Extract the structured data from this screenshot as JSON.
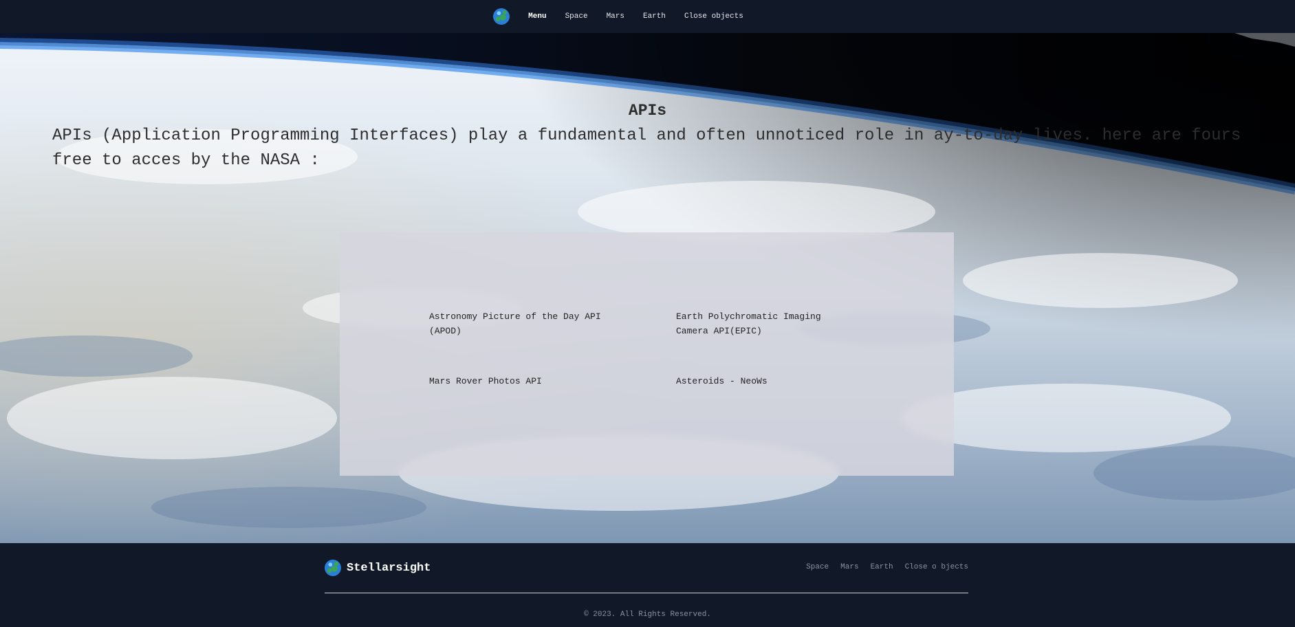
{
  "nav": {
    "logo_icon": "globe-icon",
    "items": [
      {
        "label": "Menu",
        "active": true
      },
      {
        "label": "Space"
      },
      {
        "label": "Mars"
      },
      {
        "label": "Earth"
      },
      {
        "label": "Close objects"
      }
    ]
  },
  "hero": {
    "title": "APIs",
    "description": "APIs (Application Programming Interfaces) play a fundamental and often unnoticed role in ay-to-day lives. here are fours free to acces by the NASA :",
    "apis": [
      {
        "label": "Astronomy Picture of the Day API (APOD)"
      },
      {
        "label": "Earth Polychromatic Imaging Camera API(EPIC)"
      },
      {
        "label": "Mars Rover Photos API"
      },
      {
        "label": "Asteroids - NeoWs"
      }
    ]
  },
  "footer": {
    "logo_icon": "globe-icon",
    "brand": "Stellarsight",
    "links": [
      {
        "label": "Space"
      },
      {
        "label": "Mars"
      },
      {
        "label": "Earth"
      },
      {
        "label": "Close o bjects"
      }
    ],
    "copyright": "© 2023. All Rights Reserved."
  },
  "colors": {
    "nav_bg": "#111827",
    "footer_bg": "#111827",
    "card_bg": "#d6d6de",
    "atmosphere_blue": "#3b82f6"
  }
}
